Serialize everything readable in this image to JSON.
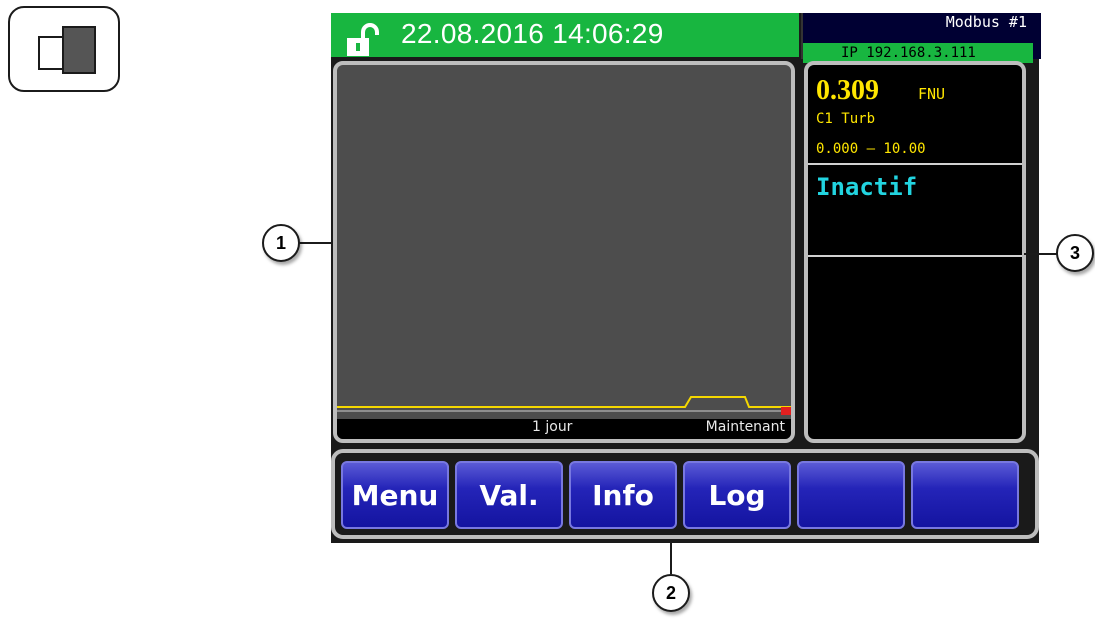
{
  "status_bar": {
    "datetime": "22.08.2016  14:06:29",
    "status_color": "#18b640"
  },
  "network": {
    "modbus_label": "Modbus  #1",
    "ip_label": "IP  192.168.3.111"
  },
  "graph": {
    "timespan_label": "1  jour",
    "now_label": "Maintenant",
    "trend_color": "#f5d800",
    "alarm_marker_color": "#e02020"
  },
  "measurement": {
    "value": "0.309",
    "unit": "FNU",
    "channel": "C1  Turb",
    "range": "0.000  –  10.00",
    "state": "Inactif",
    "value_color": "#ffe600",
    "state_color": "#22d4e0"
  },
  "softkeys": [
    {
      "label": "Menu"
    },
    {
      "label": "Val."
    },
    {
      "label": "Info"
    },
    {
      "label": "Log"
    },
    {
      "label": ""
    },
    {
      "label": ""
    }
  ],
  "callouts": [
    "1",
    "2",
    "3"
  ],
  "icons": {
    "mode": "display-mode-icon",
    "lock": "unlocked-padlock-icon"
  }
}
